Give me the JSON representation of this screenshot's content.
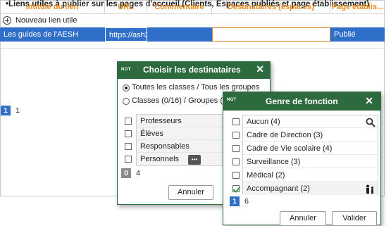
{
  "page": {
    "title": "•Liens utiles à publier sur les pages d'accueil (Clients, Espaces publiés et page établissement)"
  },
  "table": {
    "headers": [
      "Intitulé du lien",
      "URL",
      "Commentaire",
      "Destinataires (espaces)",
      "Page établis..."
    ],
    "new_row_label": "Nouveau lien utile",
    "rows": [
      {
        "title": "Les guides de l'AESH",
        "url": "https://ash3",
        "comment": "",
        "recipients": "",
        "page": "Publié"
      }
    ],
    "pager": {
      "current": "1",
      "total": "1"
    }
  },
  "dialog_recipients": {
    "tag": "NOT",
    "title": "Choisir les destinataires",
    "option_all": "Toutes les classes / Tous les groupes",
    "option_classes": "Classes (0/16) / Groupes (",
    "items": [
      {
        "label": "Professeurs",
        "checked": false
      },
      {
        "label": "Élèves",
        "checked": false
      },
      {
        "label": "Responsables",
        "checked": false
      },
      {
        "label": "Personnels",
        "checked": false,
        "has_more": true
      }
    ],
    "more_label": "•••",
    "pager": {
      "current": "0",
      "total": "4"
    },
    "cancel_label": "Annuler"
  },
  "dialog_function": {
    "tag": "NOT",
    "title": "Genre de fonction",
    "items": [
      {
        "label": "Aucun (4)",
        "checked": false
      },
      {
        "label": "Cadre de Direction (3)",
        "checked": false
      },
      {
        "label": "Cadre de Vie scolaire (4)",
        "checked": false
      },
      {
        "label": "Surveillance (3)",
        "checked": false
      },
      {
        "label": "Médical (2)",
        "checked": false
      },
      {
        "label": "Accompagnant (2)",
        "checked": true
      }
    ],
    "pager": {
      "current": "1",
      "total": "6"
    },
    "cancel_label": "Annuler",
    "validate_label": "Valider"
  },
  "colors": {
    "header_text": "#e98a1e",
    "selection_blue": "#2f6fca",
    "dialog_green": "#2d6b3f"
  }
}
